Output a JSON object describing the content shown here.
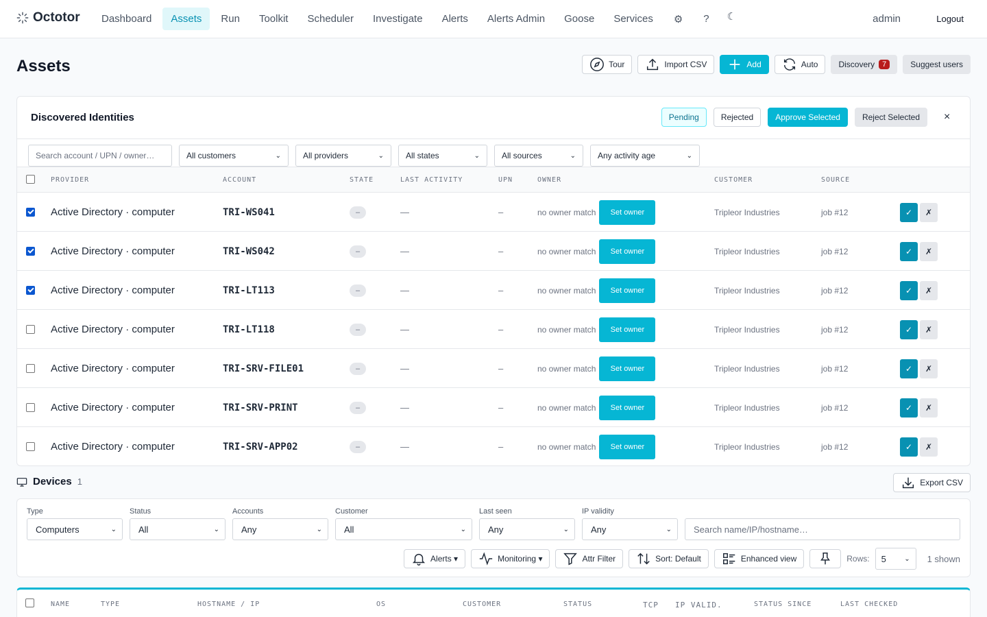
{
  "brand": {
    "name": "Octotor"
  },
  "nav": {
    "items": [
      {
        "label": "Dashboard"
      },
      {
        "label": "Assets"
      },
      {
        "label": "Run"
      },
      {
        "label": "Toolkit"
      },
      {
        "label": "Scheduler"
      },
      {
        "label": "Investigate"
      },
      {
        "label": "Alerts"
      },
      {
        "label": "Alerts Admin"
      },
      {
        "label": "Goose"
      },
      {
        "label": "Services"
      }
    ],
    "active": "Assets",
    "icons": [
      "gear-icon",
      "help-icon",
      "moon-icon"
    ],
    "settings_glyph": "⚙",
    "help_glyph": "?",
    "theme_glyph": "☾",
    "user": "admin",
    "logout": "Logout"
  },
  "page": {
    "title": "Assets",
    "actions": {
      "tour": "Tour",
      "import_csv": "Import CSV",
      "add": "Add",
      "auto": "Auto",
      "discovery": "Discovery",
      "discovery_count": "7",
      "suggest_users": "Suggest users"
    }
  },
  "identities": {
    "title": "Discovered Identities",
    "tabs": {
      "pending": "Pending",
      "rejected": "Rejected"
    },
    "approve_selected": "Approve Selected",
    "reject_selected": "Reject Selected",
    "close": "×",
    "filters": {
      "search_placeholder": "Search account / UPN / owner…",
      "customers": "All customers",
      "providers": "All providers",
      "states": "All states",
      "sources": "All sources",
      "activity": "Any activity age"
    },
    "columns": [
      "PROVIDER",
      "ACCOUNT",
      "STATE",
      "LAST ACTIVITY",
      "UPN",
      "OWNER",
      "CUSTOMER",
      "SOURCE"
    ],
    "rows": [
      {
        "checked": true,
        "provider": "Active Directory · computer",
        "account": "TRI-WS041",
        "state": "–",
        "last_activity": "—",
        "upn": "–",
        "owner": "no owner match",
        "set_owner": "Set owner",
        "customer": "Tripleor Industries",
        "source": "job #12",
        "approve": "✓",
        "reject": "✗"
      },
      {
        "checked": true,
        "provider": "Active Directory · computer",
        "account": "TRI-WS042",
        "state": "–",
        "last_activity": "—",
        "upn": "–",
        "owner": "no owner match",
        "set_owner": "Set owner",
        "customer": "Tripleor Industries",
        "source": "job #12",
        "approve": "✓",
        "reject": "✗"
      },
      {
        "checked": true,
        "provider": "Active Directory · computer",
        "account": "TRI-LT113",
        "state": "–",
        "last_activity": "—",
        "upn": "–",
        "owner": "no owner match",
        "set_owner": "Set owner",
        "customer": "Tripleor Industries",
        "source": "job #12",
        "approve": "✓",
        "reject": "✗"
      },
      {
        "checked": false,
        "provider": "Active Directory · computer",
        "account": "TRI-LT118",
        "state": "–",
        "last_activity": "—",
        "upn": "–",
        "owner": "no owner match",
        "set_owner": "Set owner",
        "customer": "Tripleor Industries",
        "source": "job #12",
        "approve": "✓",
        "reject": "✗"
      },
      {
        "checked": false,
        "provider": "Active Directory · computer",
        "account": "TRI-SRV-FILE01",
        "state": "–",
        "last_activity": "—",
        "upn": "–",
        "owner": "no owner match",
        "set_owner": "Set owner",
        "customer": "Tripleor Industries",
        "source": "job #12",
        "approve": "✓",
        "reject": "✗"
      },
      {
        "checked": false,
        "provider": "Active Directory · computer",
        "account": "TRI-SRV-PRINT",
        "state": "–",
        "last_activity": "—",
        "upn": "–",
        "owner": "no owner match",
        "set_owner": "Set owner",
        "customer": "Tripleor Industries",
        "source": "job #12",
        "approve": "✓",
        "reject": "✗"
      },
      {
        "checked": false,
        "provider": "Active Directory · computer",
        "account": "TRI-SRV-APP02",
        "state": "–",
        "last_activity": "—",
        "upn": "–",
        "owner": "no owner match",
        "set_owner": "Set owner",
        "customer": "Tripleor Industries",
        "source": "job #12",
        "approve": "✓",
        "reject": "✗"
      }
    ]
  },
  "devices": {
    "title": "Devices",
    "count": "1",
    "export": "Export CSV",
    "filters": {
      "type": {
        "label": "Type",
        "value": "Computers"
      },
      "status": {
        "label": "Status",
        "value": "All"
      },
      "accounts": {
        "label": "Accounts",
        "value": "Any"
      },
      "customer": {
        "label": "Customer",
        "value": "All"
      },
      "last_seen": {
        "label": "Last seen",
        "value": "Any"
      },
      "ip_validity": {
        "label": "IP validity",
        "value": "Any"
      },
      "search_placeholder": "Search name/IP/hostname…"
    },
    "tools": {
      "alerts": "Alerts ▾",
      "monitoring": "Monitoring ▾",
      "attr_filter": "Attr Filter",
      "sort": "Sort: Default",
      "enhanced": "Enhanced view",
      "rows_label": "Rows:",
      "rows_value": "5",
      "shown": "1 shown"
    },
    "columns": [
      "NAME",
      "TYPE",
      "HOSTNAME / IP",
      "OS",
      "CUSTOMER",
      "STATUS",
      "TCP",
      "IP VALID.",
      "STATUS SINCE",
      "LAST CHECKED"
    ]
  }
}
